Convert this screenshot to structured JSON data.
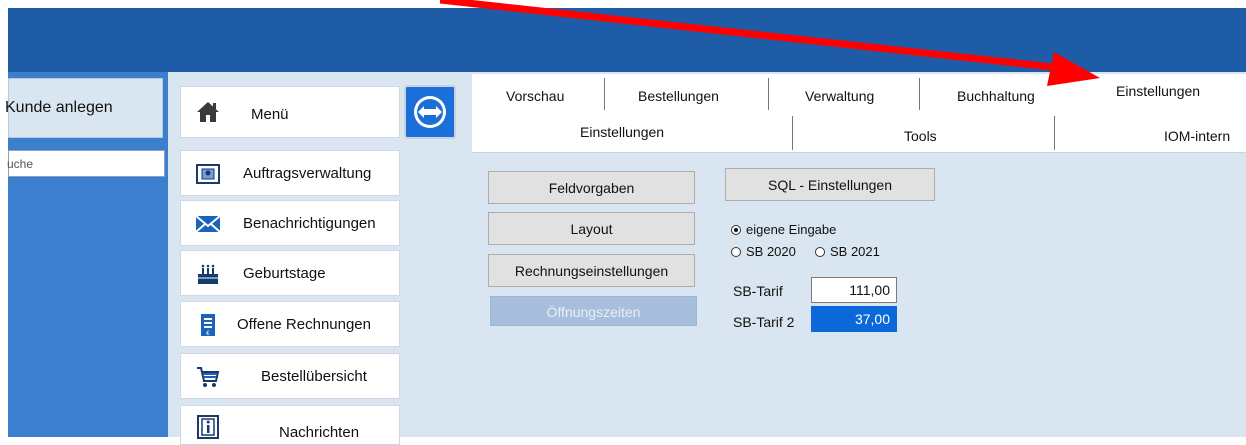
{
  "sidebar": {
    "kunde_anlegen": "Kunde anlegen",
    "search_placeholder": "uche"
  },
  "menu": {
    "items": [
      {
        "label": "Menü",
        "icon": "house-icon"
      },
      {
        "label": "Auftragsverwaltung",
        "icon": "folder-person-icon"
      },
      {
        "label": "Benachrichtigungen",
        "icon": "envelope-icon"
      },
      {
        "label": "Geburtstage",
        "icon": "birthday-cake-icon"
      },
      {
        "label": "Offene Rechnungen",
        "icon": "invoice-icon"
      },
      {
        "label": "Bestellübersicht",
        "icon": "shopping-cart-icon"
      },
      {
        "label": "Nachrichten",
        "icon": "info-icon"
      }
    ]
  },
  "toolbar": {
    "teamviewer_icon": "teamviewer-icon"
  },
  "tabs": {
    "main": [
      "Vorschau",
      "Bestellungen",
      "Verwaltung",
      "Buchhaltung",
      "Einstellungen"
    ],
    "sub": [
      "Einstellungen",
      "Tools",
      "IOM-intern"
    ]
  },
  "settings": {
    "buttons": {
      "feldvorgaben": "Feldvorgaben",
      "layout": "Layout",
      "rechnungseinstellungen": "Rechnungseinstellungen",
      "oeffnungszeiten": "Öffnungszeiten",
      "sql": "SQL - Einstellungen"
    },
    "radios": {
      "eigene": "eigene Eingabe",
      "sb2020": "SB 2020",
      "sb2021": "SB 2021"
    },
    "sb_tarif_label": "SB-Tarif",
    "sb_tarif_value": "111,00",
    "sb_tarif2_label": "SB-Tarif 2",
    "sb_tarif2_value": "37,00"
  },
  "colors": {
    "annotation_arrow": "#ff0000",
    "header": "#1f5ca8",
    "selection": "#0a68d8"
  }
}
